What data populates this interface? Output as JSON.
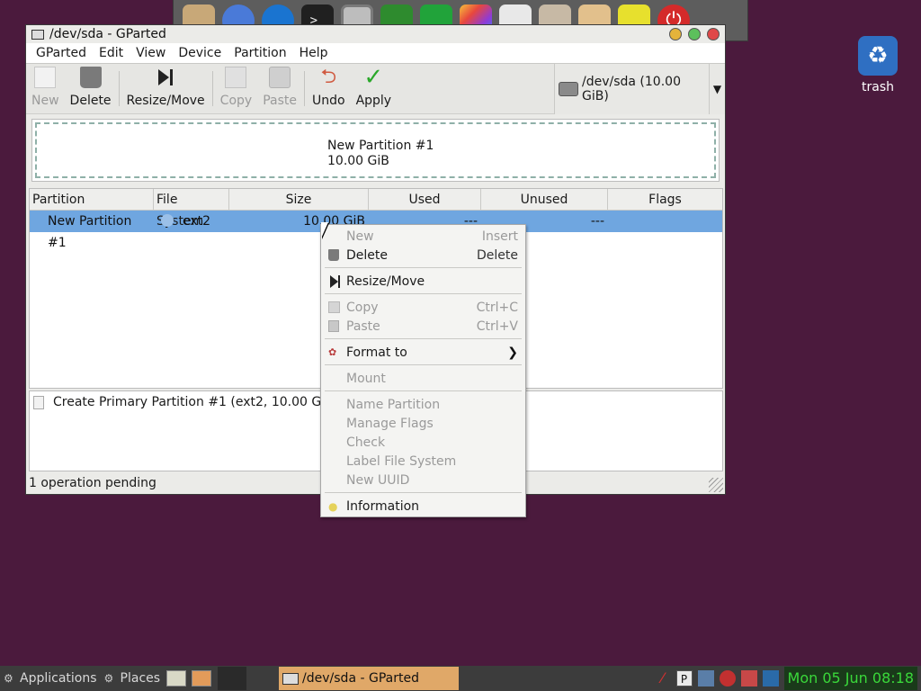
{
  "window": {
    "title": "/dev/sda - GParted"
  },
  "menubar": [
    "GParted",
    "Edit",
    "View",
    "Device",
    "Partition",
    "Help"
  ],
  "toolbar": {
    "new": "New",
    "delete": "Delete",
    "resize": "Resize/Move",
    "copy": "Copy",
    "paste": "Paste",
    "undo": "Undo",
    "apply": "Apply"
  },
  "device": {
    "label": "/dev/sda  (10.00 GiB)"
  },
  "graph": {
    "name": "New Partition #1",
    "size": "10.00 GiB"
  },
  "table": {
    "columns": [
      "Partition",
      "File System",
      "Size",
      "Used",
      "Unused",
      "Flags"
    ],
    "rows": [
      {
        "partition": "New Partition #1",
        "filesystem": "ext2",
        "size": "10.00 GiB",
        "used": "---",
        "unused": "---",
        "flags": ""
      }
    ]
  },
  "operations": {
    "items": [
      "Create Primary Partition #1 (ext2, 10.00 GiB) o"
    ]
  },
  "status": "1 operation pending",
  "context_menu": {
    "items": [
      {
        "label": "New",
        "accel": "Insert",
        "enabled": false
      },
      {
        "label": "Delete",
        "accel": "Delete",
        "enabled": true
      },
      {
        "label": "Resize/Move",
        "accel": "",
        "enabled": true
      },
      {
        "label": "Copy",
        "accel": "Ctrl+C",
        "enabled": false
      },
      {
        "label": "Paste",
        "accel": "Ctrl+V",
        "enabled": false
      },
      {
        "label": "Format to",
        "accel": "",
        "enabled": true
      },
      {
        "label": "Mount",
        "accel": "",
        "enabled": false
      },
      {
        "label": "Name Partition",
        "accel": "",
        "enabled": false
      },
      {
        "label": "Manage Flags",
        "accel": "",
        "enabled": false
      },
      {
        "label": "Check",
        "accel": "",
        "enabled": false
      },
      {
        "label": "Label File System",
        "accel": "",
        "enabled": false
      },
      {
        "label": "New UUID",
        "accel": "",
        "enabled": false
      },
      {
        "label": "Information",
        "accel": "",
        "enabled": true
      }
    ]
  },
  "desktop": {
    "trash_label": "trash"
  },
  "panel": {
    "applications": "Applications",
    "places": "Places",
    "task_label": "/dev/sda - GParted",
    "clock": "Mon 05 Jun 08:18"
  },
  "colors": {
    "desktop_bg": "#4b1a3d",
    "selection": "#6fa6e0",
    "task_active": "#e0a868",
    "clock": "#3ad83a"
  }
}
